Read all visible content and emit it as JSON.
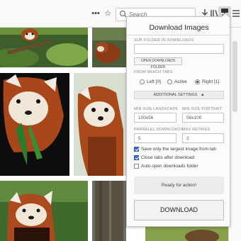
{
  "toolbar": {
    "search_placeholder": "Search"
  },
  "popup": {
    "title": "Download Images",
    "subfolder_label": "SUB FOLDER IN DOWNLOADS",
    "subfolder_value": "",
    "open_downloads_label": "OPEN DOWNLOADS FOLDER",
    "tabs_label": "FROM WHICH TABS",
    "tabs": [
      {
        "label": "Left [0]",
        "selected": false
      },
      {
        "label": "Active",
        "selected": false
      },
      {
        "label": "Right [1]",
        "selected": true
      }
    ],
    "advanced_label": "ADDITIONAL SETTINGS",
    "advanced_caret": "▲",
    "min_landscape_label": "MIN SIZE LANDSCAPE",
    "min_landscape_value": "100x56",
    "min_portrait_label": "MIN SIZE PORTRAIT",
    "min_portrait_value": "56x100",
    "parallel_label": "PARRALEL DOWNLOADS",
    "parallel_value": "5",
    "retries_label": "MAX RETRIES",
    "retries_value": "2",
    "options": [
      {
        "label": "Save only the largest image from tab",
        "checked": true
      },
      {
        "label": "Close tabs after download",
        "checked": true
      },
      {
        "label": "Auto open downloads folder",
        "checked": false
      }
    ],
    "status": "Ready for action!",
    "download_label": "DOWNLOAD"
  },
  "colors": {
    "toolbar_bg": "#f9f9fa",
    "popup_bg": "#fbfbfb",
    "checkbox_on": "#3e6ec9"
  },
  "icons": {
    "toolbar": [
      "ellipsis-icon",
      "bookmark-star-icon",
      "search-icon",
      "download-icon",
      "library-icon",
      "sidebar-icon",
      "download-images-extension-icon",
      "menu-icon"
    ]
  }
}
